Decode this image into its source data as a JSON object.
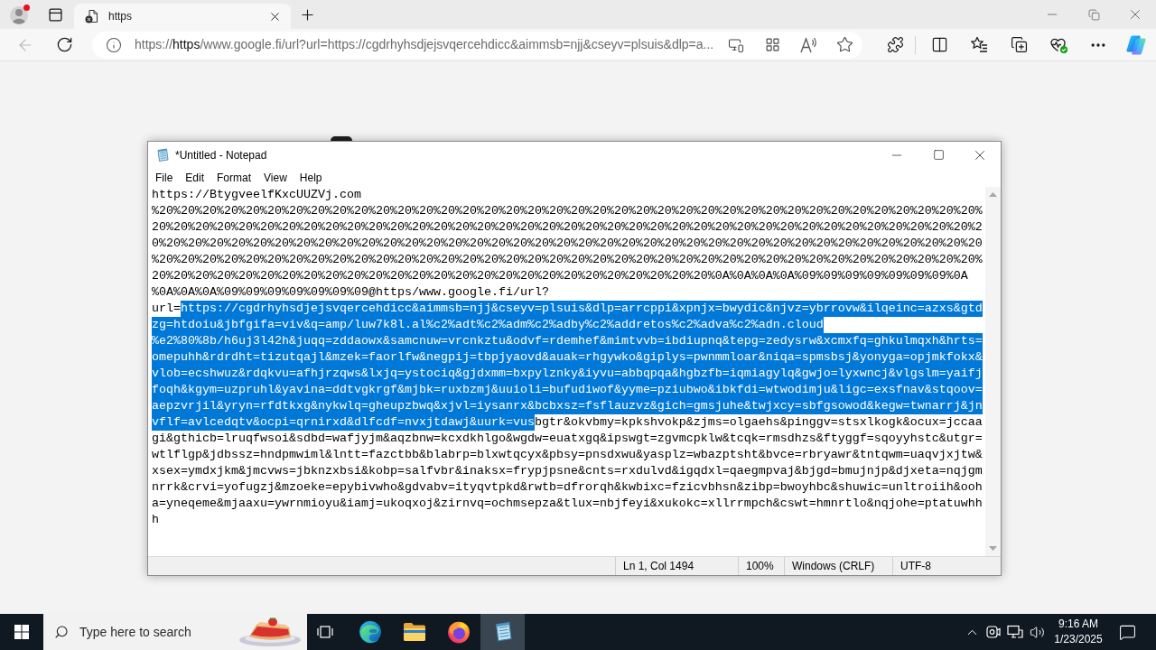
{
  "browser": {
    "tabs": [
      {
        "title": "https",
        "selected": true
      }
    ],
    "back": {
      "disabled": true
    },
    "address": {
      "segments": [
        {
          "kind": "scheme",
          "text": "https://"
        },
        {
          "kind": "host",
          "text": "https"
        },
        {
          "kind": "path",
          "text": "/www.google.fi/url?url=https://cgdrhyhsdjejsvqercehdicc&aimmsb=njj&cseyv=plsuis&dlp=a..."
        }
      ]
    }
  },
  "notepad": {
    "title": "*Untitled - Notepad",
    "menu": [
      "File",
      "Edit",
      "Format",
      "View",
      "Help"
    ],
    "lines": [
      {
        "segments": [
          {
            "text": "https://BtygveelfKxcUUZVj.com",
            "selected": false
          }
        ]
      },
      {
        "segments": [
          {
            "text": "%20%20%20%20%20%20%20%20%20%20%20%20%20%20%20%20%20%20%20%20%20%20%20%20%20%20%20%20%20%20%20%20%20%20%20%20%20%20%",
            "selected": false
          }
        ]
      },
      {
        "segments": [
          {
            "text": "20%20%20%20%20%20%20%20%20%20%20%20%20%20%20%20%20%20%20%20%20%20%20%20%20%20%20%20%20%20%20%20%20%20%20%20%20%20%2",
            "selected": false
          }
        ]
      },
      {
        "segments": [
          {
            "text": "0%20%20%20%20%20%20%20%20%20%20%20%20%20%20%20%20%20%20%20%20%20%20%20%20%20%20%20%20%20%20%20%20%20%20%20%20%20%20",
            "selected": false
          }
        ]
      },
      {
        "segments": [
          {
            "text": "%20%20%20%20%20%20%20%20%20%20%20%20%20%20%20%20%20%20%20%20%20%20%20%20%20%20%20%20%20%20%20%20%20%20%20%20%20%20%",
            "selected": false
          }
        ]
      },
      {
        "segments": [
          {
            "text": "20%20%20%20%20%20%20%20%20%20%20%20%20%20%20%20%20%20%20%20%20%20%20%20%20%20%0A%0A%0A%0A%09%09%09%09%09%09%09%0A",
            "selected": false
          }
        ]
      },
      {
        "segments": [
          {
            "text": "%0A%0A%0A%09%09%09%09%09%09%09@https/www.google.fi/url?",
            "selected": false
          }
        ]
      },
      {
        "segments": [
          {
            "text": "url=",
            "selected": false
          },
          {
            "text": "https://cgdrhyhsdjejsvqercehdicc&aimmsb=njj&cseyv=plsuis&dlp=arrcppi&xpnjx=bwydic&njvz=ybrrovw&ilqeinc=azxs&gtd",
            "selected": true
          }
        ]
      },
      {
        "segments": [
          {
            "text": "zg=htdoiu&jbfgifa=viv&q=amp/luw7k8l.al%c2%adt%c2%adm%c2%adby%c2%addretos%c2%adva%c2%adn.cloud",
            "selected": true
          }
        ]
      },
      {
        "segments": [
          {
            "text": "%e2%80%8b/h6uj3l42h&juqq=zddaowx&samcnuw=vrcnkztu&odvf=rdemhef&mimtvvb=ibdiupnq&tepg=zedysrw&xcmxfq=ghkulmqxh&hrts=",
            "selected": true
          }
        ]
      },
      {
        "segments": [
          {
            "text": "omepuhh&rdrdht=tizutqajl&mzek=faorlfw&negpij=tbpjyaovd&auak=rhgywko&giplys=pwnmmloar&niqa=spmsbsj&yonyga=opjmkfokx&",
            "selected": true
          }
        ]
      },
      {
        "segments": [
          {
            "text": "vlob=ecshwuz&rdqkvu=afhjrzqws&lxjq=ystociq&gjdxmm=bxpylznky&iyvu=abbqpqa&hgbzfb=iqmiagylq&gwjo=lyxwncj&vlgslm=yaifj",
            "selected": true
          }
        ]
      },
      {
        "segments": [
          {
            "text": "foqh&kgym=uzpruhl&yavina=ddtvgkrgf&mjbk=ruxbzmj&uuioli=bufudiwof&yyme=pziubwo&ibkfdi=wtwodimju&ligc=exsfnav&stqoov=",
            "selected": true
          }
        ]
      },
      {
        "segments": [
          {
            "text": "aepzvrjil&yryn=rfdtkxg&nykwlq=gheupzbwq&xjvl=iysanrx&bcbxsz=fsflauzvz&gich=gmsjuhe&twjxcy=sbfgsowod&kegw=twnarrj&jn",
            "selected": true
          }
        ]
      },
      {
        "segments": [
          {
            "text": "vflf=avlcedqtv&ocpi=qrnirxd&dlfcdf=nvxjtdawj&uurk=vus",
            "selected": true
          },
          {
            "text": "bgtr&okvbmy=kpkshvokp&zjms=olgaehs&pinggv=stsxlkogk&ocux=jccaa",
            "selected": false
          }
        ]
      },
      {
        "segments": [
          {
            "text": "gi&gthicb=lruqfwsoi&sdbd=wafjyjm&aqzbnw=kcxdkhlgo&wgdw=euatxgq&ipswgt=zgvmcpklw&tcqk=rmsdhzs&ftyggf=sqoyyhstc&utgr=",
            "selected": false
          }
        ]
      },
      {
        "segments": [
          {
            "text": "wtlflgp&jdbssz=hndpmwiml&lntt=fazctbb&blabrp=blxwtqcyx&pbsy=pnsdxwu&yasplz=wbazptsht&bvce=rbryawr&tntqwm=uaqvjxjtw&",
            "selected": false
          }
        ]
      },
      {
        "segments": [
          {
            "text": "xsex=ymdxjkm&jmcvws=jbknzxbsi&kobp=salfvbr&inaksx=frypjpsne&cnts=rxdulvd&igqdxl=qaegmpvaj&bjgd=bmujnjp&djxeta=nqjgm",
            "selected": false
          }
        ]
      },
      {
        "segments": [
          {
            "text": "nrrk&crvi=yofugzj&mzoeke=epybivwho&gdvabv=ityqvtpkd&rwtb=dfrorqh&kwbixc=fzicvbhsn&zibp=bwoyhbc&shuwic=unltroiih&ooh",
            "selected": false
          }
        ]
      },
      {
        "segments": [
          {
            "text": "a=yneqeme&mjaaxu=ywrnmioyu&iamj=ukoqxoj&zirnvq=ochmsepza&tlux=nbjfeyi&xukokc=xllrrmpch&cswt=hmnrtlo&nqjohe=ptatuwhh",
            "selected": false
          }
        ]
      },
      {
        "segments": [
          {
            "text": "h",
            "selected": false
          }
        ]
      }
    ],
    "status": [
      "Ln 1, Col 1494",
      "100%",
      "Windows (CRLF)",
      "UTF-8"
    ]
  },
  "taskbar": {
    "search": {
      "placeholder": "Type here to search"
    },
    "apps": [
      {
        "kind": "edge",
        "selected": false
      },
      {
        "kind": "file-explorer",
        "selected": false
      },
      {
        "kind": "firefox",
        "selected": false
      },
      {
        "kind": "notepad",
        "selected": true
      }
    ],
    "time": "9:16 AM",
    "date": "1/23/2025"
  }
}
